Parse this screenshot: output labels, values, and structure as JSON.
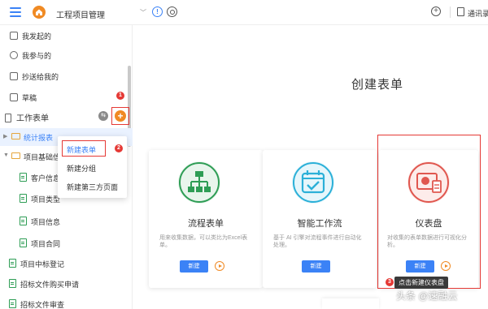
{
  "topbar": {
    "app_title": "工程项目管理",
    "contacts_label": "通讯录"
  },
  "sidebar": {
    "quick_items": [
      {
        "label": "我发起的",
        "icon": "doc-edit-icon"
      },
      {
        "label": "我参与的",
        "icon": "user-icon"
      },
      {
        "label": "抄送给我的",
        "icon": "send-icon"
      },
      {
        "label": "草稿",
        "icon": "draft-icon",
        "badge": "1"
      }
    ],
    "workspace_label": "工作表单",
    "tree": [
      {
        "label": "统计报表",
        "type": "folder",
        "level": 1,
        "selected": true
      },
      {
        "label": "项目基础信息",
        "type": "folder",
        "level": 1
      },
      {
        "label": "客户信息",
        "type": "form",
        "level": 2
      },
      {
        "label": "项目类型",
        "type": "form",
        "level": 2
      },
      {
        "label": "项目信息",
        "type": "form",
        "level": 2
      },
      {
        "label": "项目合同",
        "type": "form",
        "level": 2
      },
      {
        "label": "项目中标登记",
        "type": "form",
        "level": 1
      },
      {
        "label": "招标文件购买申请",
        "type": "form",
        "level": 1
      },
      {
        "label": "招标文件审查",
        "type": "form",
        "level": 1
      }
    ]
  },
  "dropdown": {
    "items": [
      "新建表单",
      "新建分组",
      "新建第三方页面"
    ],
    "badge": "2"
  },
  "main": {
    "title": "创建表单",
    "cards": [
      {
        "name": "流程表单",
        "desc": "用来收集数据，可以类比为Excel表单。",
        "button": "新建",
        "icon": "flowchart-icon",
        "color": "#2e9d55"
      },
      {
        "name": "智能工作流",
        "desc": "基于 AI 引擎对流程事件进行自动化处理。",
        "button": "新建",
        "icon": "calendar-check-icon",
        "color": "#2bb0d8"
      },
      {
        "name": "仪表盘",
        "desc": "对收集的表单数据进行可视化分析。",
        "button": "新建",
        "icon": "dashboard-icon",
        "color": "#e0574f"
      }
    ],
    "tooltip": "点击新建仪表盘",
    "tooltip_badge": "3"
  },
  "watermark": "头条 @速融云",
  "colors": {
    "accent": "#3b82f6",
    "orange": "#f08a24",
    "highlight": "#e53935"
  }
}
